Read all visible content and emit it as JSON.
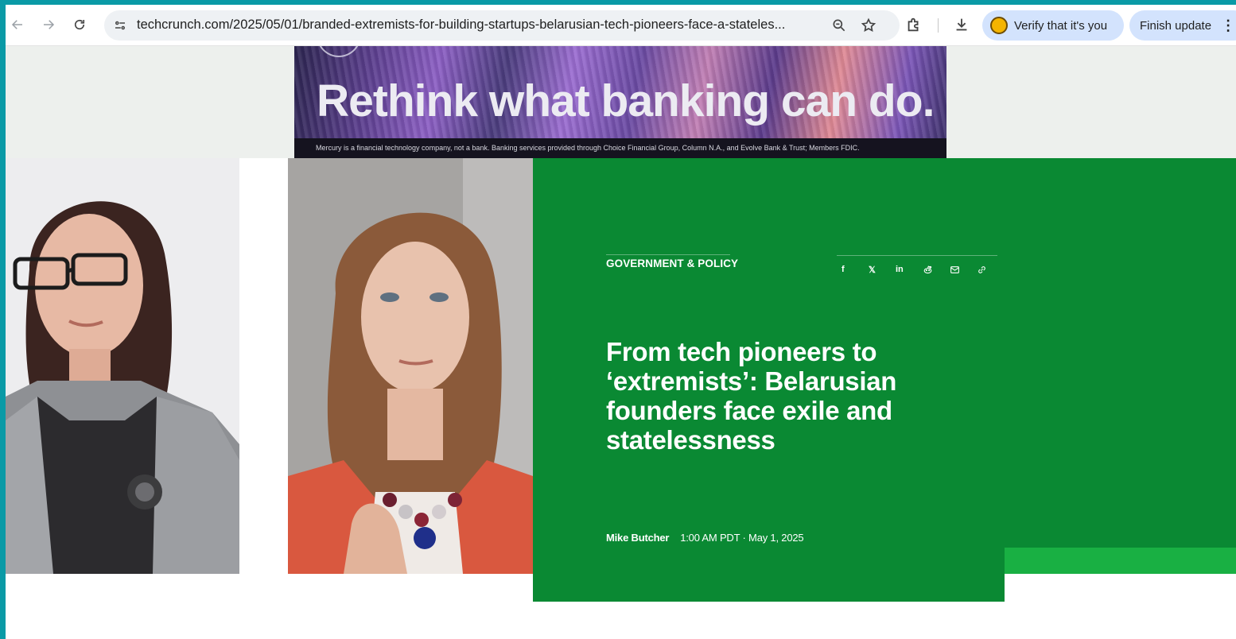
{
  "browser": {
    "url": "techcrunch.com/2025/05/01/branded-extremists-for-building-startups-belarusian-tech-pioneers-face-a-stateles...",
    "verify_label": "Verify that it's you",
    "update_label": "Finish update"
  },
  "ad": {
    "headline": "Rethink what banking can do.",
    "disclaimer": "Mercury is a financial technology company, not a bank. Banking services provided through Choice Financial Group, Column N.A., and Evolve Bank & Trust; Members FDIC."
  },
  "article": {
    "category": "GOVERNMENT & POLICY",
    "title": "From tech pioneers to ‘extremists’: Belarusian founders face exile and statelessness",
    "author": "Mike Butcher",
    "timestamp": "1:00 AM PDT · May 1, 2025",
    "share": {
      "facebook": "f",
      "x": "𝕏",
      "linkedin": "in"
    }
  },
  "colors": {
    "hero_green": "#0a8933",
    "accent_green": "#19b043",
    "frame_teal": "#0a9aa6"
  }
}
